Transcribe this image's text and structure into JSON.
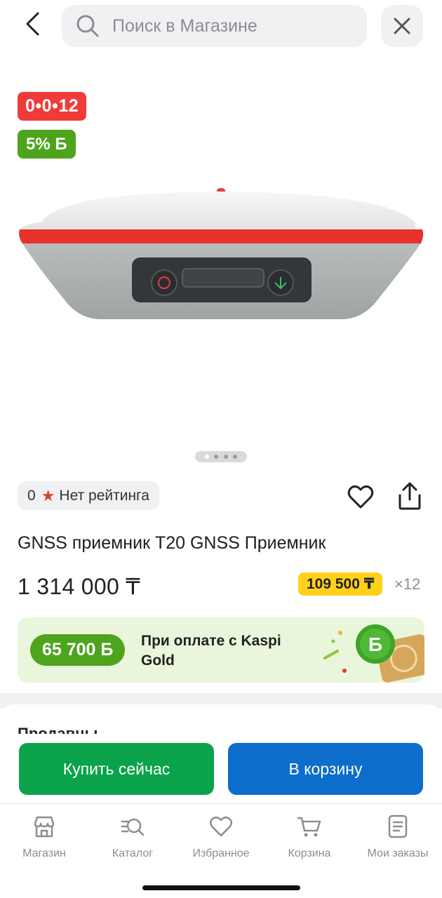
{
  "search": {
    "placeholder": "Поиск в Магазине"
  },
  "badges": {
    "timer": "0•0•12",
    "bonus": "5% Б"
  },
  "product": {
    "title": "GNSS приемник T20 GNSS Приемник",
    "price": "1 314 000 ₸",
    "installment_price": "109 500 ₸",
    "installment_count": "×12",
    "rating_value": "0",
    "rating_text": "Нет рейтинга",
    "image_count": 4,
    "active_image": 1
  },
  "kaspi_gold": {
    "amount": "65 700 Б",
    "text": "При оплате с Kaspi Gold"
  },
  "section_peek": "Продавцы",
  "actions": {
    "buy_now": "Купить сейчас",
    "add_to_cart": "В корзину"
  },
  "tabs": [
    {
      "label": "Магазин",
      "icon": "store-icon"
    },
    {
      "label": "Каталог",
      "icon": "catalog-search-icon"
    },
    {
      "label": "Избранное",
      "icon": "heart-icon"
    },
    {
      "label": "Корзина",
      "icon": "cart-icon"
    },
    {
      "label": "Мои заказы",
      "icon": "orders-icon"
    }
  ],
  "colors": {
    "timer_badge": "#ef3b3a",
    "bonus_green": "#4ea41c",
    "installment_yellow": "#ffd11a",
    "buy_green": "#0aa34b",
    "cart_blue": "#0d6dca"
  }
}
